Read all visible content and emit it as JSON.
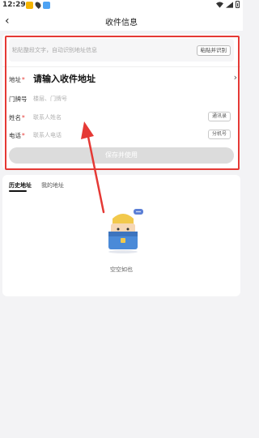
{
  "status_bar": {
    "time": "12:29"
  },
  "nav": {
    "title": "收件信息"
  },
  "paste": {
    "placeholder": "粘贴整段文字，自动识别地址信息",
    "button": "粘贴并识别"
  },
  "form": {
    "address": {
      "label": "地址",
      "placeholder": "请输入收件地址"
    },
    "door": {
      "label": "门牌号",
      "placeholder": "楼层、门牌号"
    },
    "name": {
      "label": "姓名",
      "placeholder": "联系人姓名",
      "button": "通讯录"
    },
    "phone": {
      "label": "电话",
      "placeholder": "联系人电话",
      "button": "分机号"
    },
    "required_mark": "*"
  },
  "save_button": "保存并使用",
  "tabs": [
    {
      "label": "历史地址",
      "active": true
    },
    {
      "label": "我的地址",
      "active": false
    }
  ],
  "empty_state": {
    "text": "空空如也"
  },
  "colors": {
    "highlight": "#e53935",
    "button_disabled": "#dcdcdc",
    "accent_required": "#e53935"
  }
}
